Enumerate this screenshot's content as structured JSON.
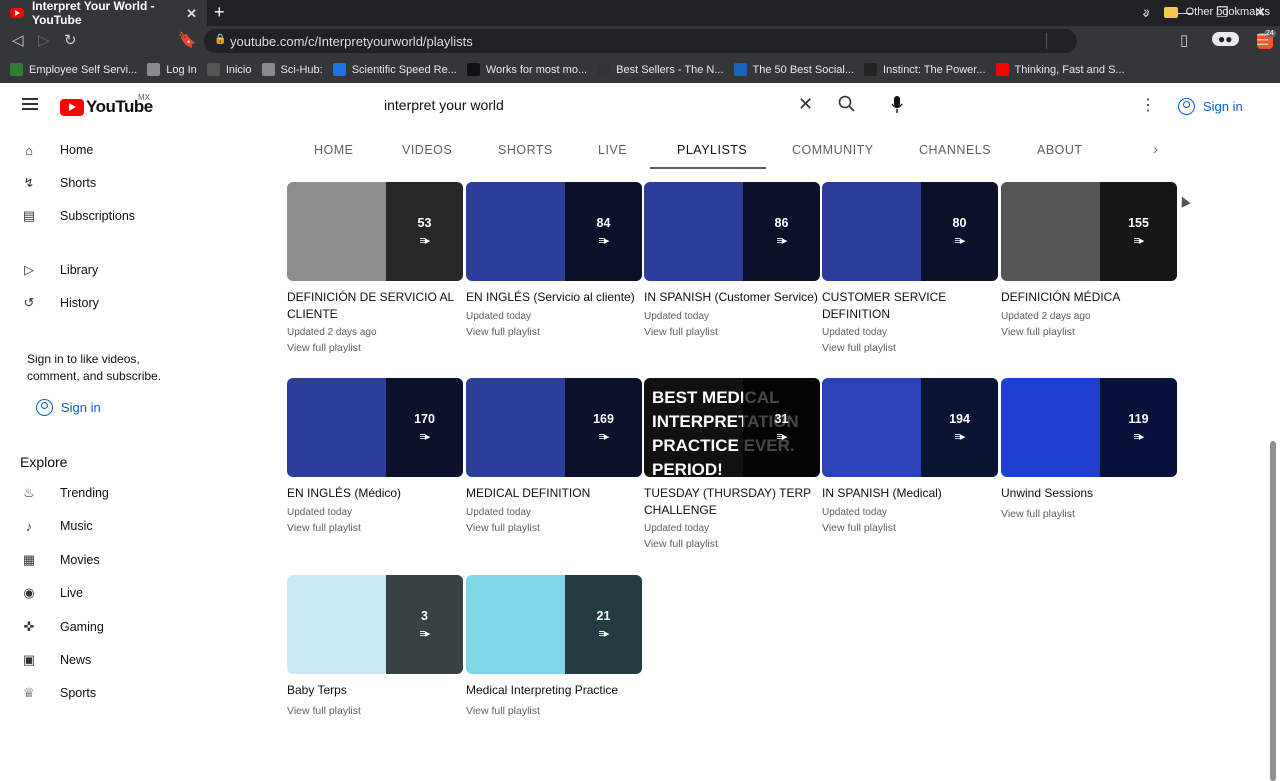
{
  "browser": {
    "tab_title": "Interpret Your World - YouTube",
    "url": "youtube.com/c/Interpretyourworld/playlists",
    "brave_badge": "24",
    "bookmarks": [
      {
        "label": "Employee Self Servi...",
        "color": "#2e7d32"
      },
      {
        "label": "Log In",
        "color": "#8a8a8a"
      },
      {
        "label": "Inicio",
        "color": "#555555"
      },
      {
        "label": "Sci-Hub:",
        "color": "#8a8a8a"
      },
      {
        "label": "Scientific Speed Re...",
        "color": "#1a73e8"
      },
      {
        "label": "Works for most mo...",
        "color": "#111111"
      },
      {
        "label": "Best Sellers - The N...",
        "color": "#333333"
      },
      {
        "label": "The 50 Best Social...",
        "color": "#1565c0"
      },
      {
        "label": "Instinct: The Power...",
        "color": "#222222"
      },
      {
        "label": "Thinking, Fast and S...",
        "color": "#ff0000"
      }
    ],
    "other_bookmarks": "Other bookmarks"
  },
  "youtube": {
    "logo_text": "YouTube",
    "region": "MX",
    "search_value": "interpret your world",
    "sign_in": "Sign in",
    "sidebar": {
      "items": [
        {
          "label": "Home",
          "icon": "home-icon",
          "glyph": "⌂"
        },
        {
          "label": "Shorts",
          "icon": "shorts-icon",
          "glyph": "↯"
        },
        {
          "label": "Subscriptions",
          "icon": "subscriptions-icon",
          "glyph": "▤"
        },
        {
          "label": "Library",
          "icon": "library-icon",
          "glyph": "▷"
        },
        {
          "label": "History",
          "icon": "history-icon",
          "glyph": "↺"
        }
      ],
      "signin_prompt": "Sign in to like videos, comment, and subscribe.",
      "signin_button": "Sign in",
      "explore_heading": "Explore",
      "explore_items": [
        {
          "label": "Trending",
          "icon": "trending-icon",
          "glyph": "♨"
        },
        {
          "label": "Music",
          "icon": "music-icon",
          "glyph": "♪"
        },
        {
          "label": "Movies",
          "icon": "movies-icon",
          "glyph": "▦"
        },
        {
          "label": "Live",
          "icon": "live-icon",
          "glyph": "◉"
        },
        {
          "label": "Gaming",
          "icon": "gaming-icon",
          "glyph": "✜"
        },
        {
          "label": "News",
          "icon": "news-icon",
          "glyph": "▣"
        },
        {
          "label": "Sports",
          "icon": "sports-icon",
          "glyph": "♕"
        }
      ]
    },
    "tabs": [
      "HOME",
      "VIDEOS",
      "SHORTS",
      "LIVE",
      "PLAYLISTS",
      "COMMUNITY",
      "CHANNELS",
      "ABOUT"
    ],
    "active_tab": "PLAYLISTS",
    "playlists": [
      {
        "title": "DEFINICIÓN DE SERVICIO AL CLIENTE",
        "count": "53",
        "updated": "Updated 2 days ago",
        "view": "View full playlist",
        "bg": "#8d8d8d"
      },
      {
        "title": "EN INGLÉS (Servicio al cliente)",
        "count": "84",
        "updated": "Updated today",
        "view": "View full playlist",
        "bg": "#2c3e9a"
      },
      {
        "title": "IN SPANISH (Customer Service)",
        "count": "86",
        "updated": "Updated today",
        "view": "View full playlist",
        "bg": "#2c3e9a"
      },
      {
        "title": "CUSTOMER SERVICE DEFINITION",
        "count": "80",
        "updated": "Updated today",
        "view": "View full playlist",
        "bg": "#2c3e9a"
      },
      {
        "title": "DEFINICIÓN MÉDICA",
        "count": "155",
        "updated": "Updated 2 days ago",
        "view": "View full playlist",
        "bg": "#555555"
      },
      {
        "title": "EN INGLÉS (Médico)",
        "count": "170",
        "updated": "Updated today",
        "view": "View full playlist",
        "bg": "#2c3e9a"
      },
      {
        "title": "MEDICAL DEFINITION",
        "count": "169",
        "updated": "Updated today",
        "view": "View full playlist",
        "bg": "#2c3e9a"
      },
      {
        "title": "TUESDAY (THURSDAY) TERP CHALLENGE",
        "count": "31",
        "updated": "Updated today",
        "view": "View full playlist",
        "bg": "#111111",
        "thumb_text": "BEST MEDICAL INTERPRETATION PRACTICE EVER. PERIOD!"
      },
      {
        "title": "IN SPANISH (Medical)",
        "count": "194",
        "updated": "Updated today",
        "view": "View full playlist",
        "bg": "#2a44b8"
      },
      {
        "title": "Unwind Sessions",
        "count": "119",
        "updated": "",
        "view": "View full playlist",
        "bg": "#1f3fd1"
      },
      {
        "title": "Baby Terps",
        "count": "3",
        "updated": "",
        "view": "View full playlist",
        "bg": "#c9e9f2"
      },
      {
        "title": "Medical Interpreting Practice",
        "count": "21",
        "updated": "",
        "view": "View full playlist",
        "bg": "#7fd6e8"
      }
    ]
  }
}
